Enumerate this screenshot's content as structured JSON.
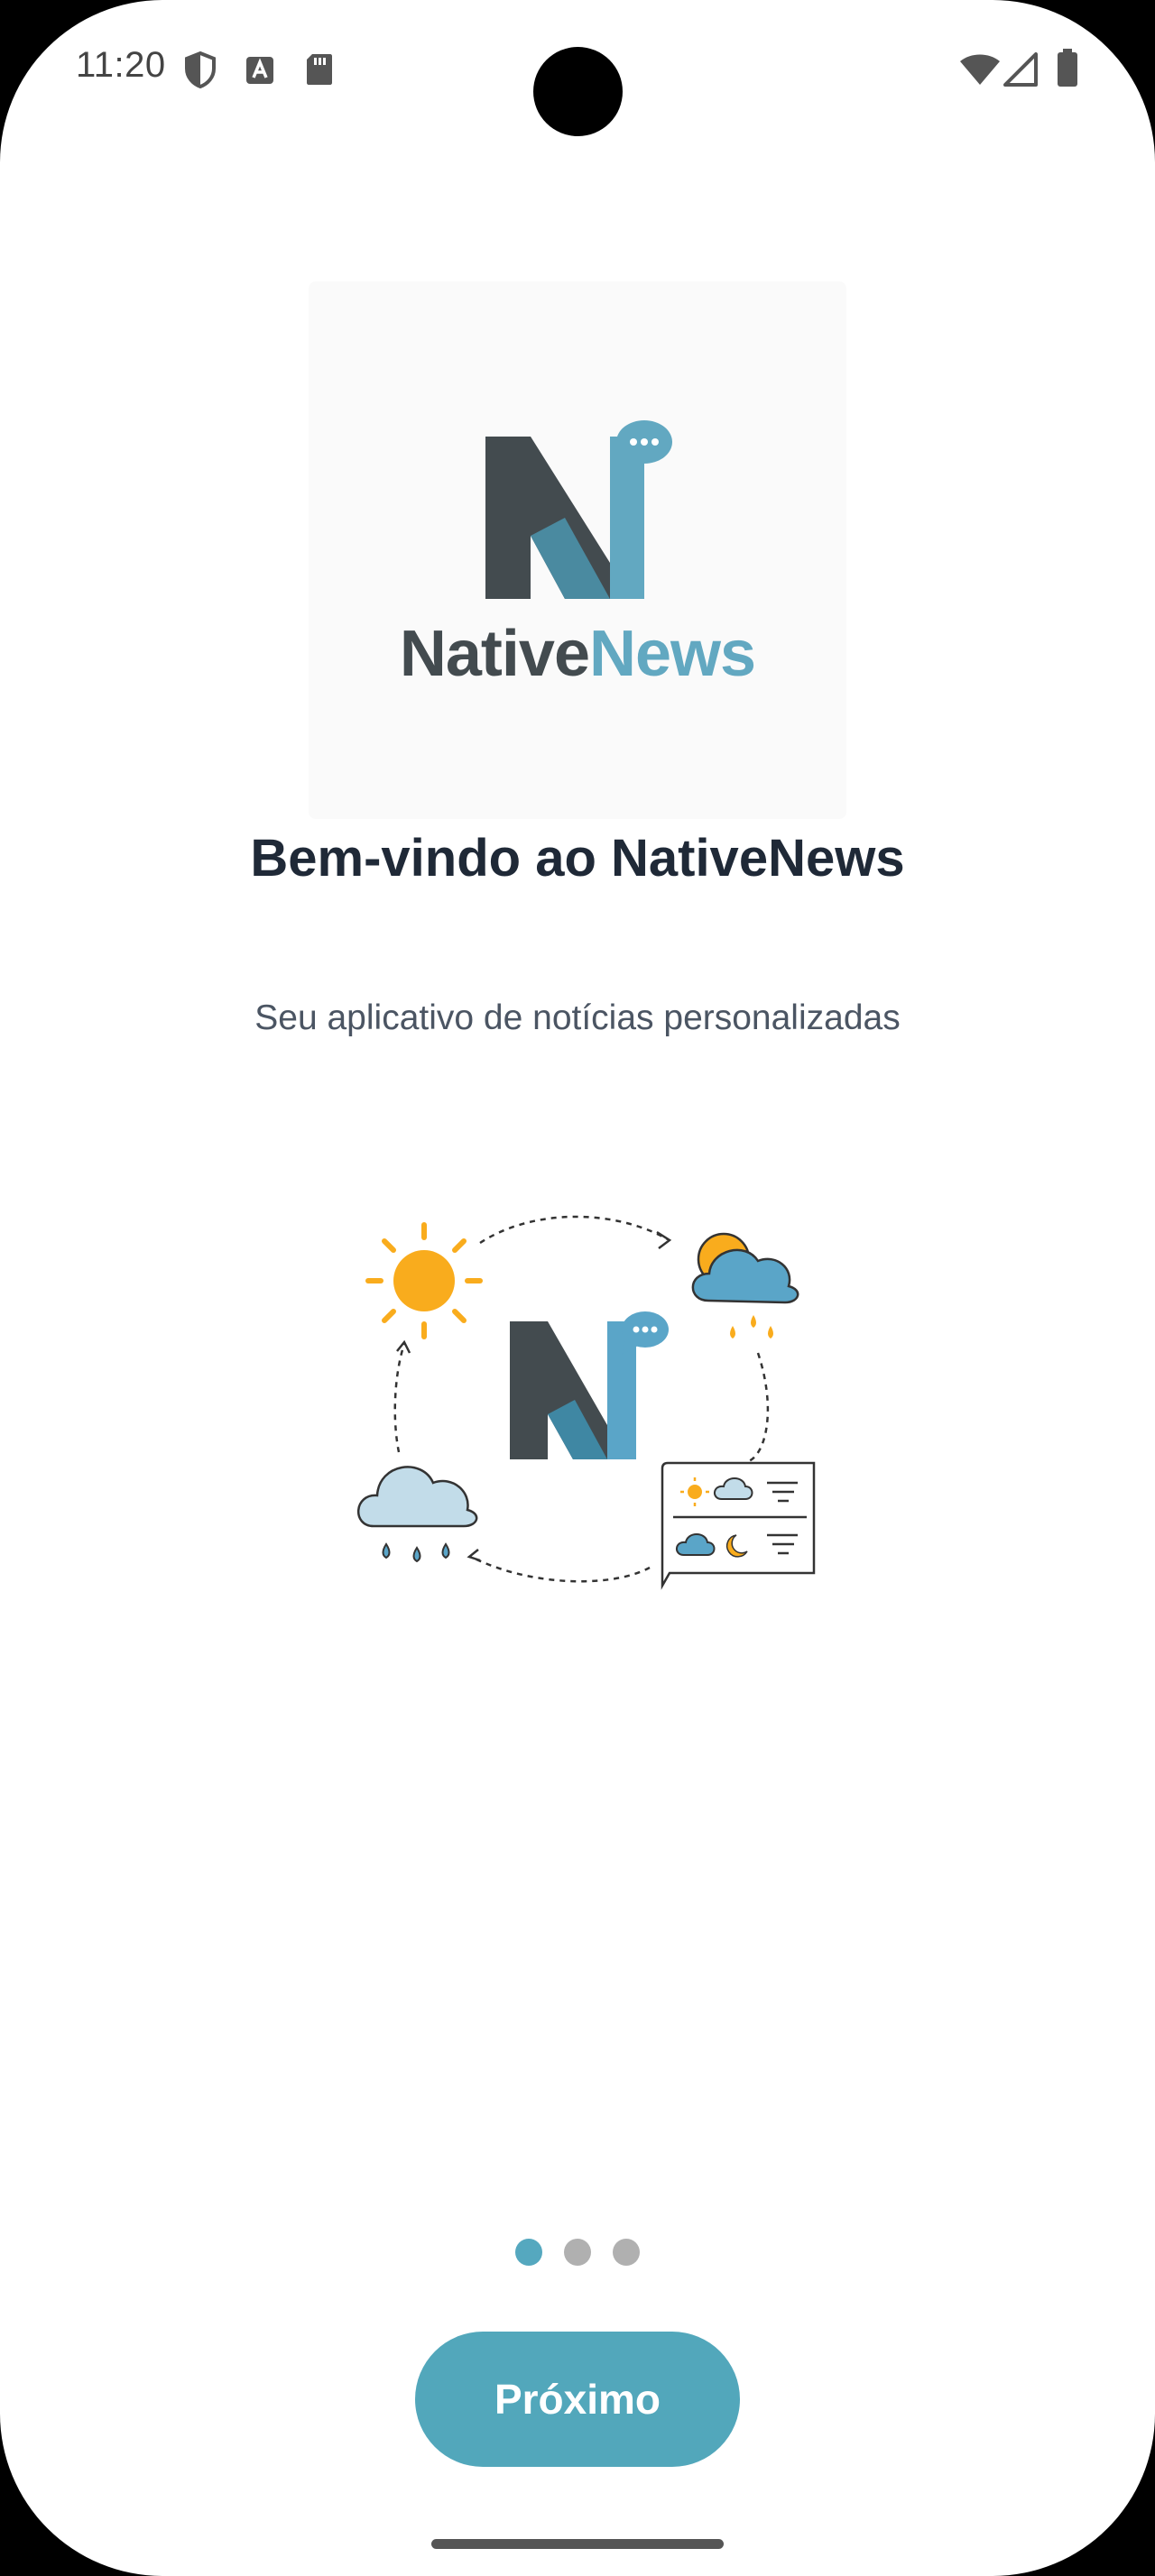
{
  "status_bar": {
    "time": "11:20",
    "left_icons": [
      "shield-icon",
      "text-a-icon",
      "sd-card-icon"
    ],
    "right_icons": [
      "wifi-icon",
      "cell-signal-icon",
      "battery-icon"
    ]
  },
  "logo": {
    "word_part1": "Native",
    "word_part2": "News",
    "color_dark": "#434b4f",
    "color_accent": "#62a8c1"
  },
  "onboarding": {
    "title": "Bem-vindo ao NativeNews",
    "subtitle": "Seu aplicativo de notícias personalizadas",
    "illustration_icons": [
      "sun-icon",
      "partly-cloudy-rain-icon",
      "rain-cloud-icon",
      "weather-forecast-bubble-icon",
      "n-logo-icon"
    ]
  },
  "pager": {
    "total": 3,
    "current": 1
  },
  "buttons": {
    "next_label": "Próximo"
  },
  "colors": {
    "accent": "#52a7bb",
    "title": "#1f2937",
    "subtitle": "#4b5563",
    "sun": "#f9ac1d"
  }
}
